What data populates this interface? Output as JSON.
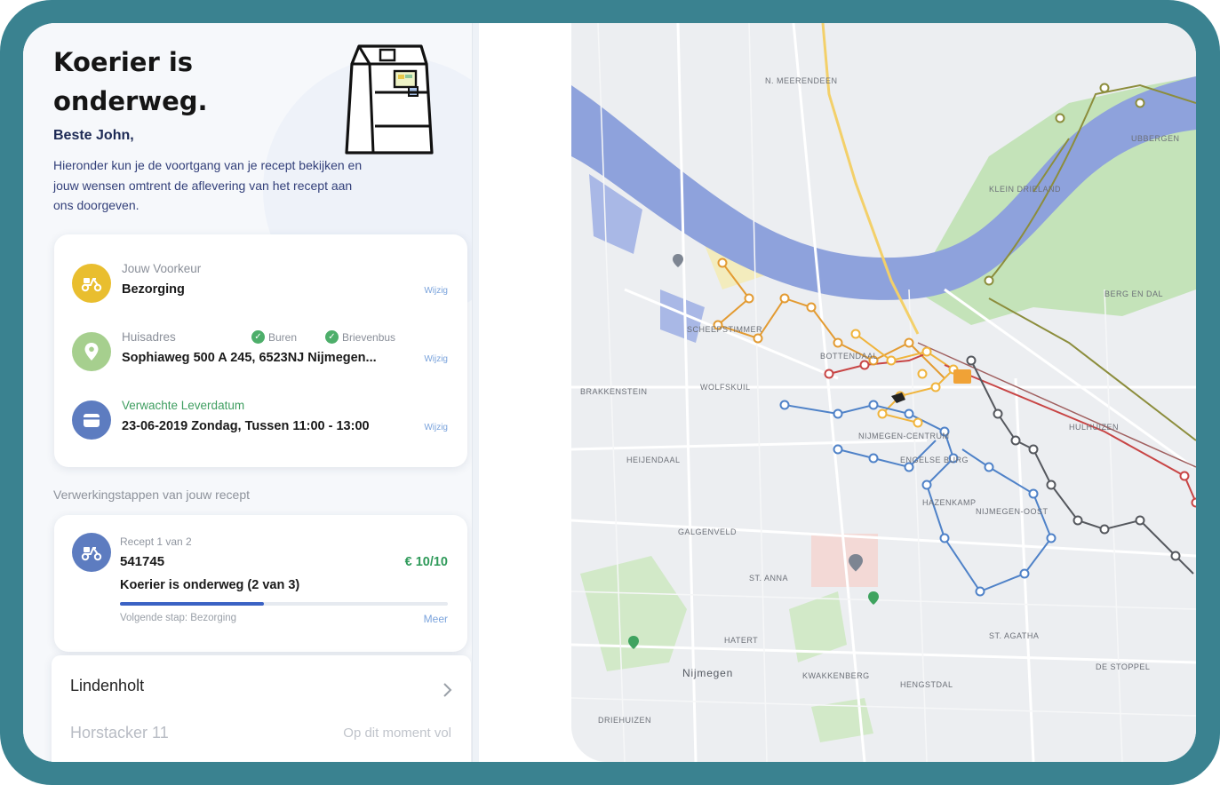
{
  "header": {
    "title": "Koerier is\nonderweg.",
    "greeting": "Beste John,",
    "intro": "Hieronder kun je de voortgang van je recept bekijken en jouw wensen omtrent de aflevering van het recept aan ons doorgeven."
  },
  "preferences": {
    "delivery": {
      "label": "Jouw Voorkeur",
      "value": "Bezorging",
      "edit": "Wijzig"
    },
    "address": {
      "label": "Huisadres",
      "value": "Sophiaweg 500 A 245, 6523NJ Nijmegen...",
      "edit": "Wijzig",
      "options": [
        "Buren",
        "Brievenbus"
      ]
    },
    "date": {
      "label": "Verwachte Leverdatum",
      "value": "23-06-2019  Zondag, Tussen 11:00 - 13:00",
      "edit": "Wijzig"
    }
  },
  "steps": {
    "section_label": "Verwerkingstappen van jouw recept",
    "recipe": {
      "count": "Recept 1 van 2",
      "number": "541745",
      "price": "€ 10/10",
      "status": "Koerier is onderweg (2 van 3)",
      "progress": 0.44,
      "next_step": "Volgende stap: Bezorging",
      "more": "Meer"
    }
  },
  "location": {
    "name": "Lindenholt",
    "address": "Horstacker 11",
    "status": "Op dit moment vol"
  },
  "map": {
    "labels": [
      "N. MEERENDEEN",
      "Nijmegen",
      "BOTTENDAAL",
      "HAZENKAMP",
      "WOLFSKUIL",
      "HEIJENDAAL",
      "NIJMEGEN-CENTRUM",
      "GALGENVELD",
      "ST. ANNA",
      "HATERT",
      "KWAKKENBERG",
      "NIJMEGEN-OOST",
      "SCHEEPSTIMMER",
      "BRAKKENSTEIN",
      "DRIEHUIZEN",
      "HENGSTDAL",
      "UBBERGEN",
      "HULHUIZEN",
      "ENGELSE BURG",
      "KLEIN DRIELAND",
      "ST. AGATHA",
      "BERG EN DAL",
      "DE STOPPEL"
    ],
    "colors": {
      "water": "#8ea2dc",
      "park": "#c4e3b9",
      "route_yellow": "#f0b43c",
      "route_orange": "#e39b32",
      "route_blue": "#4f82c8",
      "route_gray": "#55585e",
      "route_red": "#c84545",
      "route_olive": "#8c8d3c"
    }
  }
}
